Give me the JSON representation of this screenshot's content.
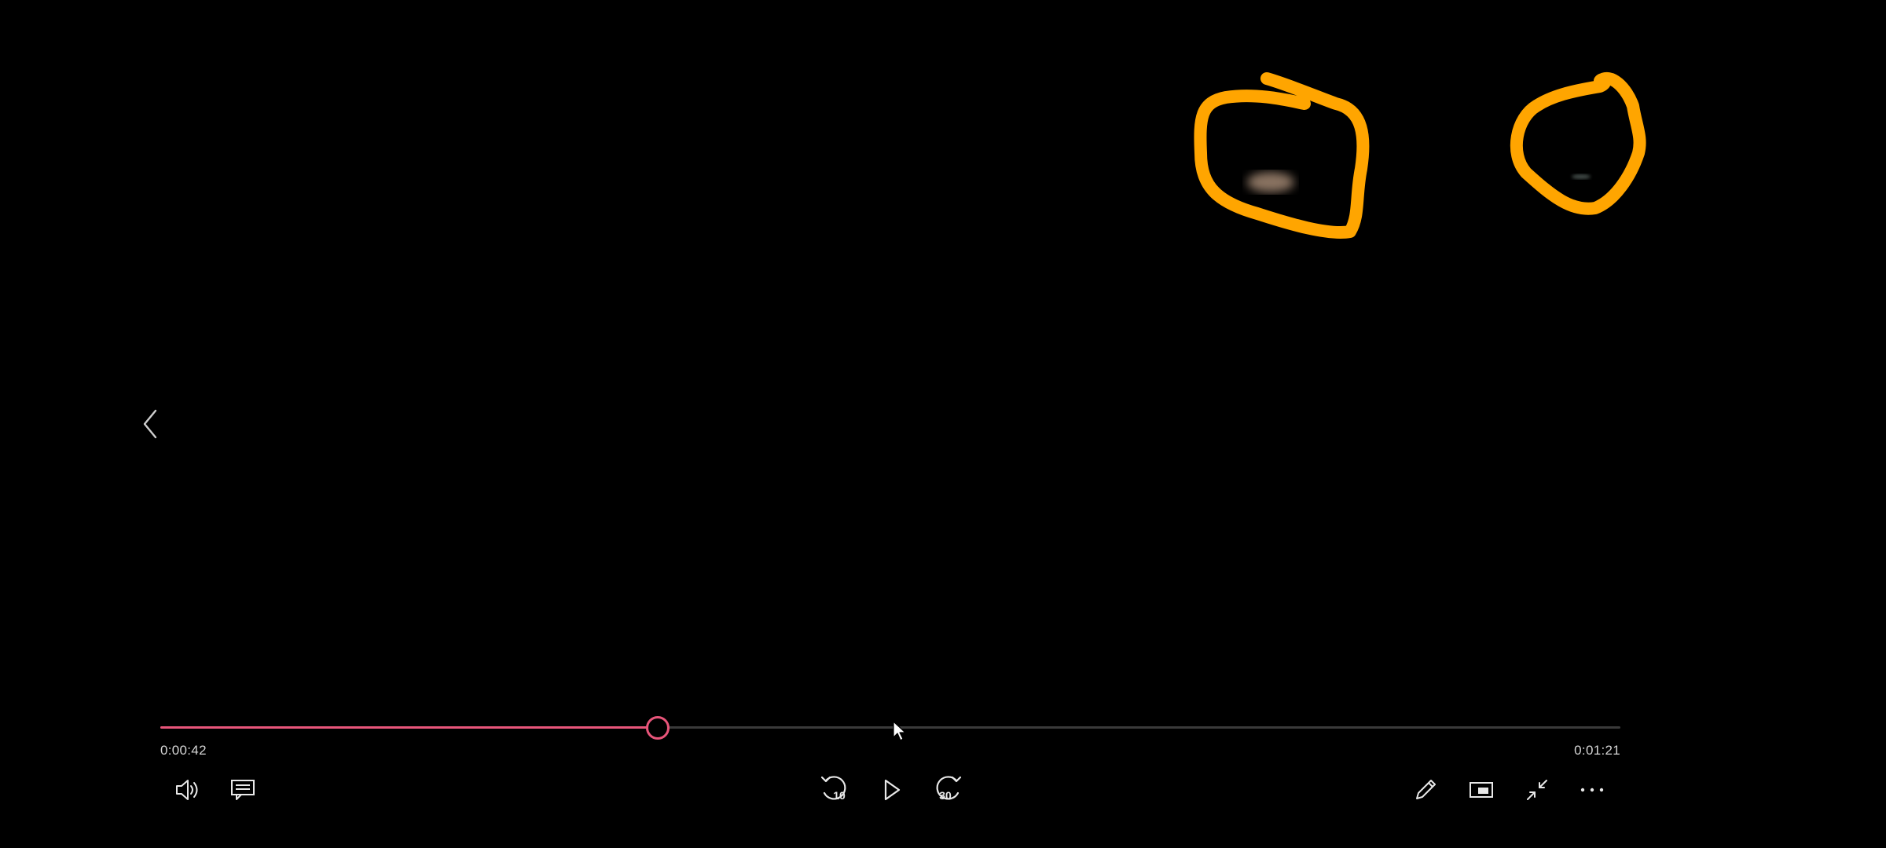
{
  "player": {
    "back_icon": "chevron-left-icon",
    "progress": {
      "current_time": "0:00:42",
      "total_time": "0:01:21",
      "fraction": 0.34,
      "accent_color": "#e8557a",
      "track_color": "#3a3a3a"
    },
    "controls_left": [
      {
        "name": "volume-button",
        "icon": "speaker-icon"
      },
      {
        "name": "subtitles-button",
        "icon": "captions-icon"
      }
    ],
    "controls_center": {
      "skip_back_label": "10",
      "skip_back_icon": "rewind-icon",
      "play_icon": "play-icon",
      "skip_forward_label": "30",
      "skip_forward_icon": "fast-forward-icon"
    },
    "controls_right": [
      {
        "name": "edit-button",
        "icon": "pencil-icon"
      },
      {
        "name": "mini-view-button",
        "icon": "picture-in-picture-icon"
      },
      {
        "name": "exit-fullscreen-button",
        "icon": "collapse-arrows-icon"
      },
      {
        "name": "more-options-button",
        "icon": "ellipsis-icon"
      }
    ]
  },
  "annotations": {
    "color": "#ffa500",
    "shapes": [
      "hand-drawn-circle",
      "hand-drawn-circle"
    ]
  }
}
